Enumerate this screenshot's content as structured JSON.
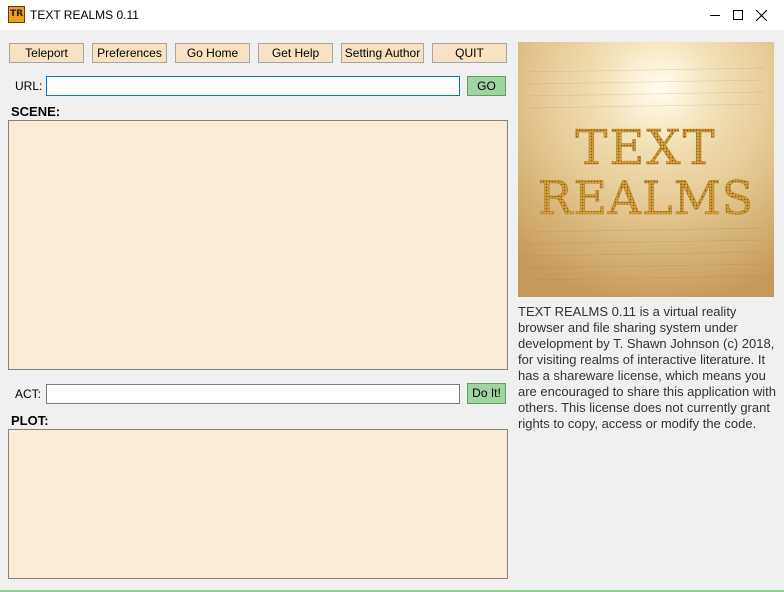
{
  "window": {
    "title": "TEXT REALMS 0.11",
    "icon_text": "TR"
  },
  "toolbar": {
    "buttons": [
      {
        "label": "Teleport"
      },
      {
        "label": "Preferences"
      },
      {
        "label": "Go Home"
      },
      {
        "label": "Get Help"
      },
      {
        "label": "Setting Author"
      },
      {
        "label": "QUIT"
      }
    ]
  },
  "url_bar": {
    "label": "URL:",
    "value": "",
    "go_label": "GO"
  },
  "scene": {
    "label": "SCENE:",
    "content": ""
  },
  "act": {
    "label": "ACT:",
    "value": "",
    "do_label": "Do It!"
  },
  "plot": {
    "label": "PLOT:",
    "content": ""
  },
  "logo": {
    "line1": "TEXT",
    "line2": "REALMS"
  },
  "description": "TEXT REALMS 0.11  is a virtual reality browser and file sharing system under development by T. Shawn Johnson (c) 2018, for visiting realms of interactive literature.  It has a shareware license, which means you are encouraged to share this application with others.  This license does not currently grant rights to copy, access or modify the code.",
  "colors": {
    "button_bg": "#f8e2c4",
    "green_button": "#9fd39f",
    "pane_bg": "#faebd7",
    "logo_gold": "#d9a441"
  }
}
